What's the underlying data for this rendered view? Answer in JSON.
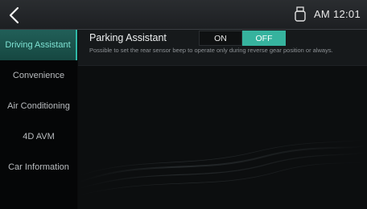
{
  "topbar": {
    "back_icon": "chevron-left-icon",
    "usb_icon": "usb-icon",
    "clock": "AM 12:01"
  },
  "sidebar": {
    "items": [
      {
        "label": "Driving Assistant",
        "active": true
      },
      {
        "label": "Convenience",
        "active": false
      },
      {
        "label": "Air Conditioning",
        "active": false
      },
      {
        "label": "4D AVM",
        "active": false
      },
      {
        "label": "Car Information",
        "active": false
      }
    ]
  },
  "main": {
    "setting": {
      "title": "Parking Assistant",
      "description": "Possible to set the rear sensor beep to operate only during reverse gear position or always.",
      "on_label": "ON",
      "off_label": "OFF",
      "selected": "OFF"
    }
  },
  "colors": {
    "accent": "#36b39e",
    "active_text": "#7fe3d4"
  }
}
